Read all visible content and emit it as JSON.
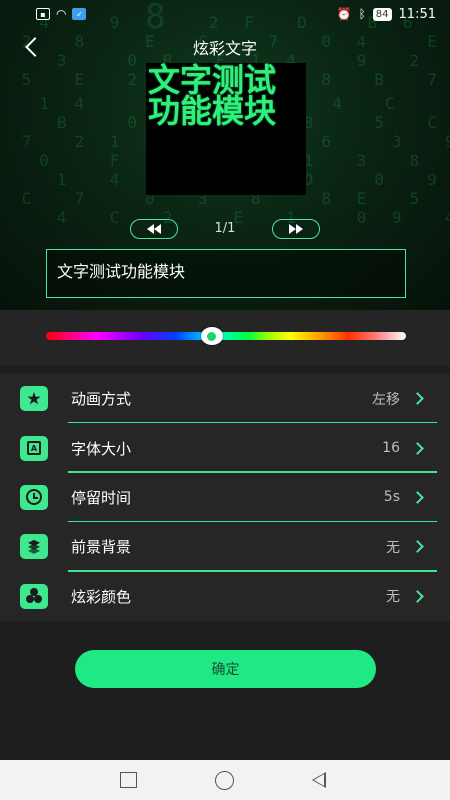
{
  "status_bar": {
    "battery": "84",
    "time": "11:51"
  },
  "header": {
    "title": "炫彩文字"
  },
  "preview": {
    "line1": "文字测试",
    "line2": "功能模块"
  },
  "pager": {
    "indicator": "1/1"
  },
  "text_input": {
    "value": "文字测试功能模块"
  },
  "color_slider": {
    "position_fraction": 0.46
  },
  "settings": [
    {
      "label": "动画方式",
      "value": "左移",
      "icon": "star-icon"
    },
    {
      "label": "字体大小",
      "value": "16",
      "icon": "font-size-icon"
    },
    {
      "label": "停留时间",
      "value": "5s",
      "icon": "clock-icon"
    },
    {
      "label": "前景背景",
      "value": "无",
      "icon": "layers-icon"
    },
    {
      "label": "炫彩颜色",
      "value": "无",
      "icon": "color-palette-icon"
    }
  ],
  "confirm": {
    "label": "确定"
  },
  "colors": {
    "accent": "#3ee88e",
    "button": "#1fe984",
    "preview_text": "#2ef07a"
  }
}
